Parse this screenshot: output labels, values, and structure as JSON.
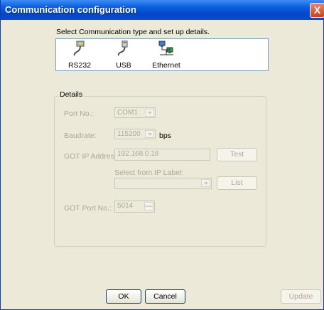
{
  "window": {
    "title": "Communication configuration",
    "close_label": "X"
  },
  "instruction": "Select Communication type and set up details.",
  "comm_types": [
    {
      "label": "RS232",
      "icon": "serial-cable-icon"
    },
    {
      "label": "USB",
      "icon": "usb-cable-icon"
    },
    {
      "label": "Ethernet",
      "icon": "network-computers-icon"
    }
  ],
  "details": {
    "group_title": "Details",
    "port_no": {
      "label": "Port No.:",
      "value": "COM1"
    },
    "baudrate": {
      "label": "Baudrate:",
      "value": "115200",
      "unit": "bps"
    },
    "got_ip": {
      "label": "GOT IP Address:",
      "value": "192.168.0.18",
      "test_label": "Test"
    },
    "ip_label": {
      "label": "Select from IP Label:",
      "value": "",
      "list_label": "List"
    },
    "got_port": {
      "label": "GOT Port No.:",
      "value": "5014"
    }
  },
  "buttons": {
    "ok": "OK",
    "cancel": "Cancel",
    "update": "Update"
  }
}
